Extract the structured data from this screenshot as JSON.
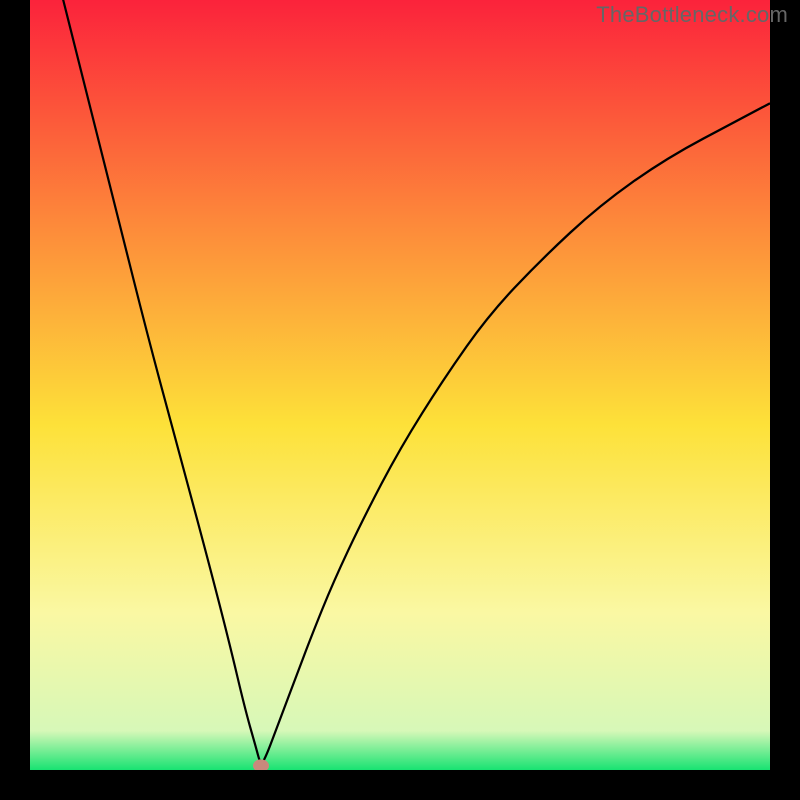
{
  "watermark": "TheBottleneck.com",
  "colors": {
    "gradient_top": "#fb1c3b",
    "gradient_mid_upper": "#fd883a",
    "gradient_mid": "#fde139",
    "gradient_mid_lower": "#faf8a3",
    "gradient_lower": "#d7f8b8",
    "gradient_bottom": "#18e372",
    "curve": "#000000",
    "frame": "#000000",
    "dot": "#c9897c"
  },
  "chart_data": {
    "type": "line",
    "title": "",
    "xlabel": "",
    "ylabel": "",
    "xlim": [
      0,
      100
    ],
    "ylim": [
      0,
      100
    ],
    "series": [
      {
        "name": "curve",
        "x": [
          4,
          8,
          12,
          16,
          20,
          24,
          27,
          29,
          30.5,
          31.2,
          32,
          33,
          34,
          36,
          38,
          41,
          45,
          50,
          56,
          62,
          69,
          77,
          86,
          96,
          100
        ],
        "values": [
          100,
          85,
          70,
          55,
          41,
          27,
          16,
          8,
          3,
          0.5,
          2,
          4.5,
          7,
          12,
          17,
          24,
          32,
          41,
          50,
          58,
          65,
          72,
          78,
          83,
          85
        ]
      }
    ],
    "min_point": {
      "x": 31.2,
      "y": 0.5
    },
    "annotations": []
  }
}
